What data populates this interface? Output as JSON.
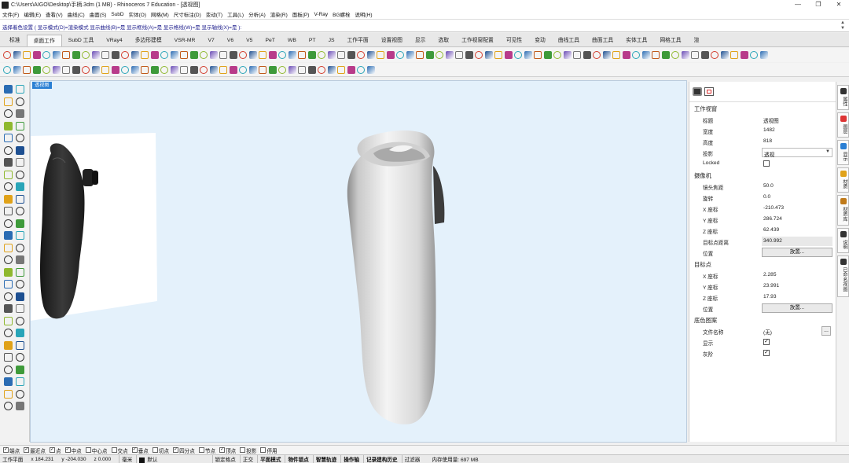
{
  "window": {
    "title": "C:\\Users\\AIGO\\Desktop\\手柄.3dm (1 MB) - Rhinoceros 7 Education - [透视图]",
    "controls": [
      "—",
      "❐",
      "✕"
    ]
  },
  "menu": [
    "文件(F)",
    "编辑(E)",
    "查看(V)",
    "曲线(C)",
    "曲面(S)",
    "SubD",
    "实体(O)",
    "网格(M)",
    "尺寸标注(D)",
    "变动(T)",
    "工具(L)",
    "分析(A)",
    "渲染(R)",
    "面板(P)",
    "V-Ray",
    "BG螺栓",
    "说明(H)"
  ],
  "command_prompt": "选择着色设置 ( 显示模式(D)=渲染模式  显示曲线(B)=是  显示框线(A)=是  显示格线(W)=是  显示轴线(X)=是 ):",
  "toolbar_tabs": {
    "active": "桌面工作",
    "items": [
      "标准",
      "桌面工作",
      "SubD 工具",
      "VRay4",
      "多边形建模",
      "VSR-MR",
      "V7",
      "V6",
      "V5",
      "PeT",
      "WB",
      "PT",
      "JS",
      "工作平面",
      "设置视图",
      "显示",
      "选取",
      "工作视窗配置",
      "可见性",
      "变动",
      "曲线工具",
      "曲面工具",
      "实体工具",
      "网格工具",
      "渲"
    ]
  },
  "viewport": {
    "label": "透视图",
    "background_color": "#e4f1fb",
    "model_color": "#e6e6e6",
    "reference_image_color": "#2a2a2a"
  },
  "properties": {
    "top_icons": [
      "camera-icon",
      "rectangle-icon"
    ],
    "section_viewport": "工作视窗",
    "viewport_rows": [
      {
        "label": "标题",
        "value": "透视图"
      },
      {
        "label": "宽度",
        "value": "1482"
      },
      {
        "label": "高度",
        "value": "818"
      }
    ],
    "projection": {
      "label": "投影",
      "value": "透视"
    },
    "locked": {
      "label": "Locked",
      "checked": false
    },
    "section_camera": "摄像机",
    "camera_rows": [
      {
        "label": "镜头焦距",
        "value": "50.0"
      },
      {
        "label": "旋转",
        "value": "0.0"
      },
      {
        "label": "X 座标",
        "value": "-210.473"
      },
      {
        "label": "Y 座标",
        "value": "286.724"
      },
      {
        "label": "Z 座标",
        "value": "62.439"
      }
    ],
    "target_distance": {
      "label": "目标点距离",
      "value": "340.992"
    },
    "camera_position": {
      "label": "位置",
      "button": "放置..."
    },
    "section_target": "目标点",
    "target_rows": [
      {
        "label": "X 座标",
        "value": "2.285"
      },
      {
        "label": "Y 座标",
        "value": "23.991"
      },
      {
        "label": "Z 座标",
        "value": "17.93"
      }
    ],
    "target_position": {
      "label": "位置",
      "button": "放置..."
    },
    "section_wallpaper": "底色图案",
    "file_name": {
      "label": "文件名称",
      "value": "(无)",
      "button": "..."
    },
    "show": {
      "label": "显示",
      "checked": true
    },
    "gray": {
      "label": "灰阶",
      "checked": true
    }
  },
  "right_tabs": [
    "属性",
    "图层",
    "显示",
    "材质",
    "材质库",
    "说明",
    "已命名视图"
  ],
  "osnap": [
    {
      "label": "端点",
      "checked": true
    },
    {
      "label": "最近点",
      "checked": true
    },
    {
      "label": "点",
      "checked": true
    },
    {
      "label": "中点",
      "checked": true
    },
    {
      "label": "中心点",
      "checked": false
    },
    {
      "label": "交点",
      "checked": false
    },
    {
      "label": "垂点",
      "checked": true
    },
    {
      "label": "切点",
      "checked": false
    },
    {
      "label": "四分点",
      "checked": true
    },
    {
      "label": "节点",
      "checked": false
    },
    {
      "label": "顶点",
      "checked": true
    },
    {
      "label": "投影",
      "checked": false
    },
    {
      "label": "停用",
      "checked": false
    }
  ],
  "status": {
    "cplane": "工作平面",
    "x": "x 184.231",
    "y": "y -204.030",
    "z": "z 0.000",
    "units": "毫米",
    "layer": "默认",
    "toggles": [
      "锁定格点",
      "正交",
      "平面模式",
      "物件锁点",
      "智慧轨迹",
      "操作轴",
      "记录建构历史",
      "过滤器"
    ],
    "memory": "内存使用量: 697 MB"
  },
  "colors": {
    "accent": "#2a7fd4",
    "panel_bg": "#ffffff",
    "toolbar_bg": "#f4f4f4"
  }
}
